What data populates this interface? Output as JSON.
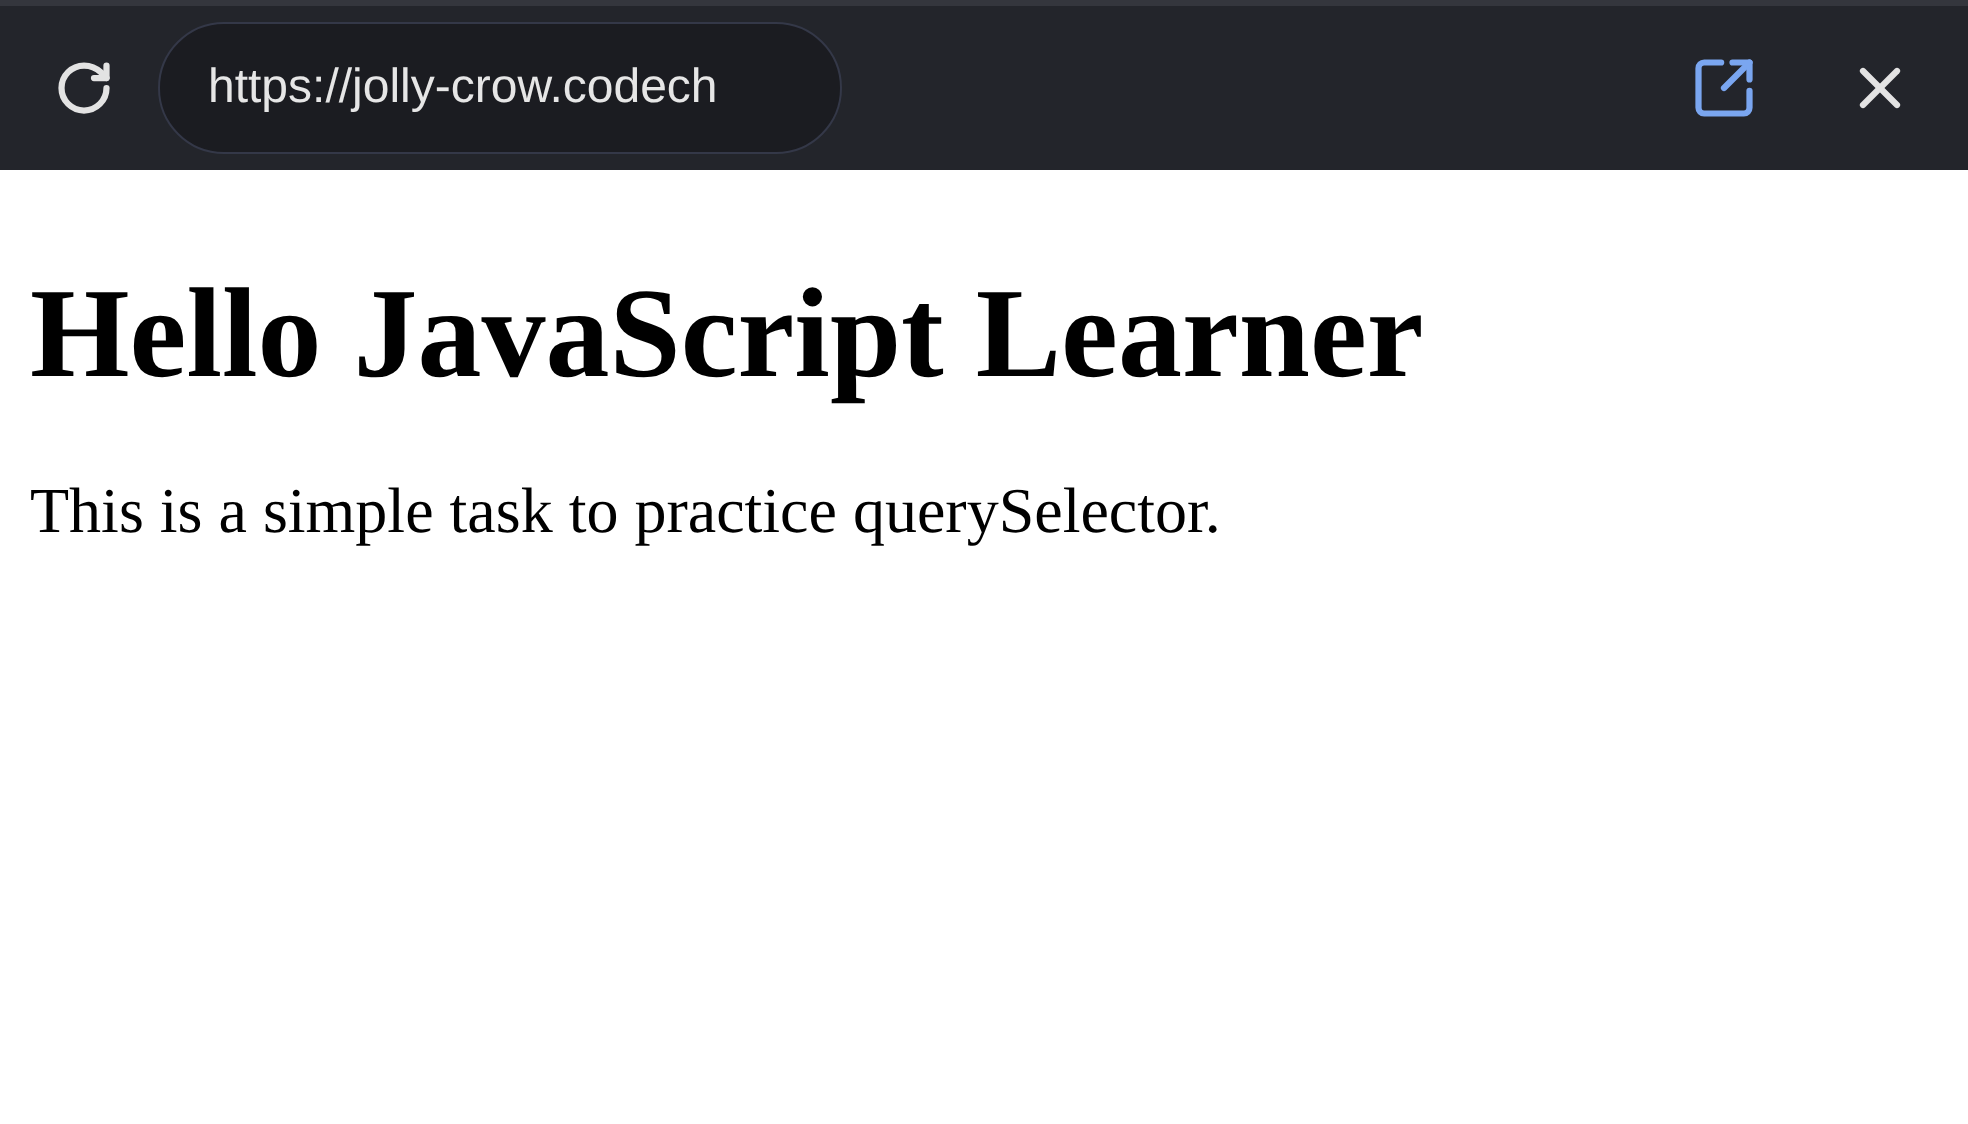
{
  "toolbar": {
    "url": "https://jolly-crow.codech"
  },
  "page": {
    "heading": "Hello JavaScript Learner",
    "paragraph": "This is a simple task to practice querySelector."
  }
}
